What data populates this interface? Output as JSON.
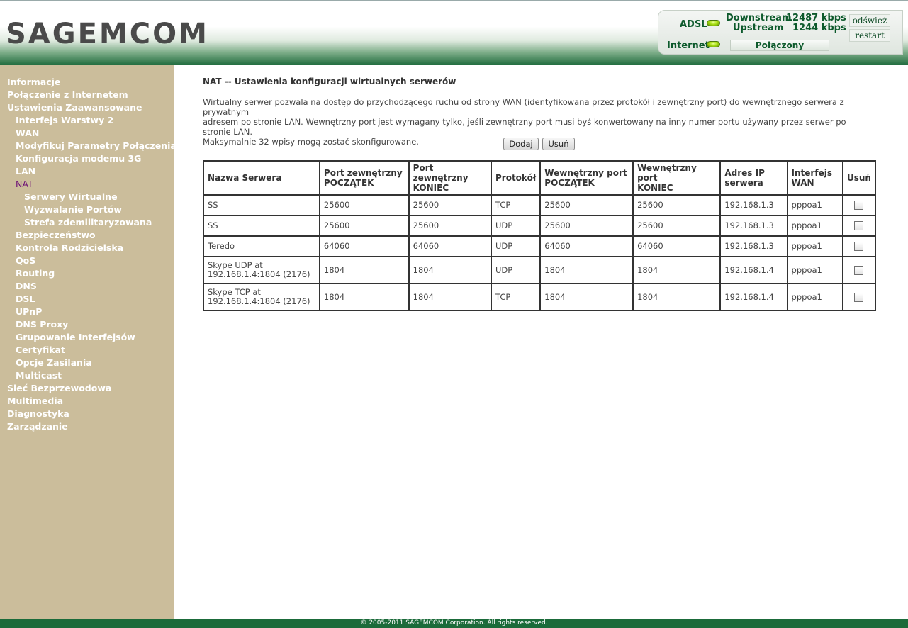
{
  "header": {
    "logo": "SAGEMCOM",
    "adsl_label": "ADSL",
    "internet_label": "Internet",
    "downstream_label": "Downstream",
    "downstream_value": "12487 kbps",
    "upstream_label": "Upstream",
    "upstream_value": "1244 kbps",
    "refresh_button": "odśwież",
    "restart_button": "restart",
    "connection_status": "Połączony",
    "led_color": "#a9e012"
  },
  "sidebar": {
    "background": "#cbbd9b",
    "items": [
      {
        "label": "Informacje"
      },
      {
        "label": "Połączenie z Internetem"
      },
      {
        "label": "Ustawienia Zaawansowane"
      },
      {
        "label": "Interfejs Warstwy 2"
      },
      {
        "label": "WAN"
      },
      {
        "label": "Modyfikuj Parametry Połączenia"
      },
      {
        "label": "Konfiguracja modemu 3G"
      },
      {
        "label": "LAN"
      },
      {
        "label": "NAT",
        "active": true
      },
      {
        "label": "Serwery Wirtualne"
      },
      {
        "label": "Wyzwalanie Portów"
      },
      {
        "label": "Strefa zdemilitaryzowana"
      },
      {
        "label": "Bezpieczeństwo"
      },
      {
        "label": "Kontrola Rodzicielska"
      },
      {
        "label": "QoS"
      },
      {
        "label": "Routing"
      },
      {
        "label": "DNS"
      },
      {
        "label": "DSL"
      },
      {
        "label": "UPnP"
      },
      {
        "label": "DNS Proxy"
      },
      {
        "label": "Grupowanie Interfejsów"
      },
      {
        "label": "Certyfikat"
      },
      {
        "label": "Opcje Zasilania"
      },
      {
        "label": "Multicast"
      },
      {
        "label": "Sieć Bezprzewodowa"
      },
      {
        "label": "Multimedia"
      },
      {
        "label": "Diagnostyka"
      },
      {
        "label": "Zarządzanie"
      }
    ]
  },
  "main": {
    "title": "NAT -- Ustawienia konfiguracji wirtualnych serwerów",
    "description_line1": "Wirtualny serwer pozwala na dostęp do przychodzącego ruchu od strony WAN (identyfikowana przez protokół i zewnętrzny port) do wewnętrznego serwera z prywatnym",
    "description_line2": "adresem po stronie LAN. Wewnętrzny port jest wymagany tylko, jeśli zewnętrzny port musi byś konwertowany na inny numer portu używany przez serwer po stronie LAN.",
    "description_line3": "Maksymalnie 32 wpisy mogą zostać skonfigurowane.",
    "add_button": "Dodaj",
    "remove_button": "Usuń",
    "table": {
      "headers": {
        "server_name": "Nazwa Serwera",
        "ext_start_1": "Port zewnętrzny",
        "ext_start_2": "POCZĄTEK",
        "ext_end_1": "Port zewnętrzny",
        "ext_end_2": "KONIEC",
        "protocol": "Protokół",
        "int_start_1": "Wewnętrzny port",
        "int_start_2": "POCZĄTEK",
        "int_end_1": "Wewnętrzny port",
        "int_end_2": "KONIEC",
        "ip_1": "Adres IP",
        "ip_2": "serwera",
        "wan_1": "Interfejs",
        "wan_2": "WAN",
        "remove": "Usuń"
      },
      "rows": [
        {
          "name1": "SS",
          "name2": "",
          "ext_start": "25600",
          "ext_end": "25600",
          "protocol": "TCP",
          "int_start": "25600",
          "int_end": "25600",
          "ip": "192.168.1.3",
          "wan": "pppoa1"
        },
        {
          "name1": "SS",
          "name2": "",
          "ext_start": "25600",
          "ext_end": "25600",
          "protocol": "UDP",
          "int_start": "25600",
          "int_end": "25600",
          "ip": "192.168.1.3",
          "wan": "pppoa1"
        },
        {
          "name1": "Teredo",
          "name2": "",
          "ext_start": "64060",
          "ext_end": "64060",
          "protocol": "UDP",
          "int_start": "64060",
          "int_end": "64060",
          "ip": "192.168.1.3",
          "wan": "pppoa1"
        },
        {
          "name1": "Skype UDP at",
          "name2": "192.168.1.4:1804 (2176)",
          "ext_start": "1804",
          "ext_end": "1804",
          "protocol": "UDP",
          "int_start": "1804",
          "int_end": "1804",
          "ip": "192.168.1.4",
          "wan": "pppoa1"
        },
        {
          "name1": "Skype TCP at",
          "name2": "192.168.1.4:1804 (2176)",
          "ext_start": "1804",
          "ext_end": "1804",
          "protocol": "TCP",
          "int_start": "1804",
          "int_end": "1804",
          "ip": "192.168.1.4",
          "wan": "pppoa1"
        }
      ]
    }
  },
  "footer": {
    "text": "© 2005-2011 SAGEMCOM Corporation. All rights reserved.",
    "color": "#1b6b3a"
  }
}
